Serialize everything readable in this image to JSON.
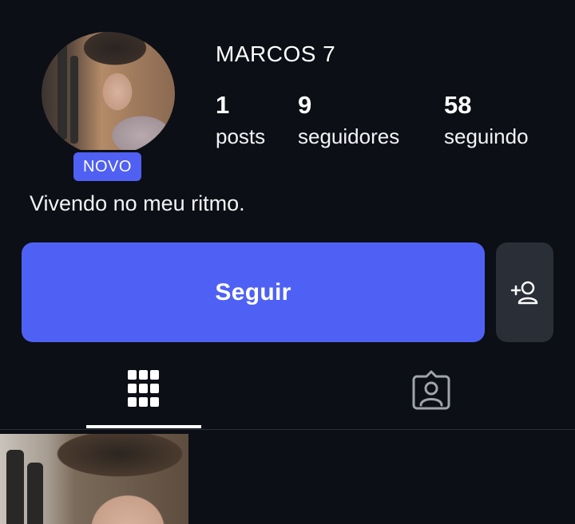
{
  "profile": {
    "username": "MARCOS 7",
    "badge": "NOVO",
    "bio": "Vivendo no meu ritmo.",
    "avatar_alt": "profile-photo"
  },
  "stats": [
    {
      "value": "1",
      "label": "posts"
    },
    {
      "value": "9",
      "label": "seguidores"
    },
    {
      "value": "58",
      "label": "seguindo"
    }
  ],
  "actions": {
    "follow_label": "Seguir",
    "add_friend_icon": "add-person-icon"
  },
  "tabs": [
    {
      "icon": "grid-icon",
      "active": true
    },
    {
      "icon": "tagged-person-icon",
      "active": false
    }
  ],
  "colors": {
    "background": "#0c0f15",
    "accent": "#4f61f4",
    "secondary_button": "#2a2e37",
    "text": "#ffffff"
  }
}
